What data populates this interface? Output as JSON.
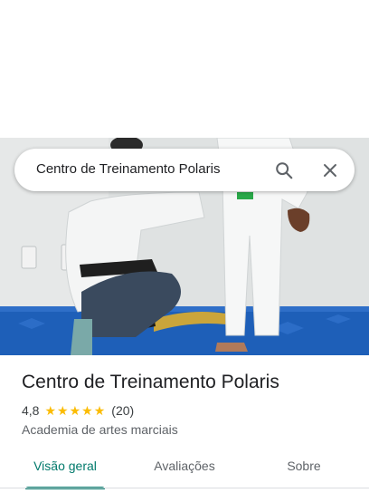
{
  "search": {
    "query": "Centro de Treinamento Polaris"
  },
  "icons": {
    "search": "search-icon",
    "close": "close-icon",
    "star": "star-icon"
  },
  "place": {
    "name": "Centro de Treinamento Polaris",
    "rating": "4,8",
    "stars": 5,
    "reviews": "(20)",
    "category": "Academia de artes marciais"
  },
  "tabs": [
    {
      "label": "Visão geral",
      "active": true
    },
    {
      "label": "Avaliações",
      "active": false
    },
    {
      "label": "Sobre",
      "active": false
    }
  ],
  "colors": {
    "accent": "#00796b",
    "star": "#fbbc04",
    "mat": "#1e5fb8"
  }
}
